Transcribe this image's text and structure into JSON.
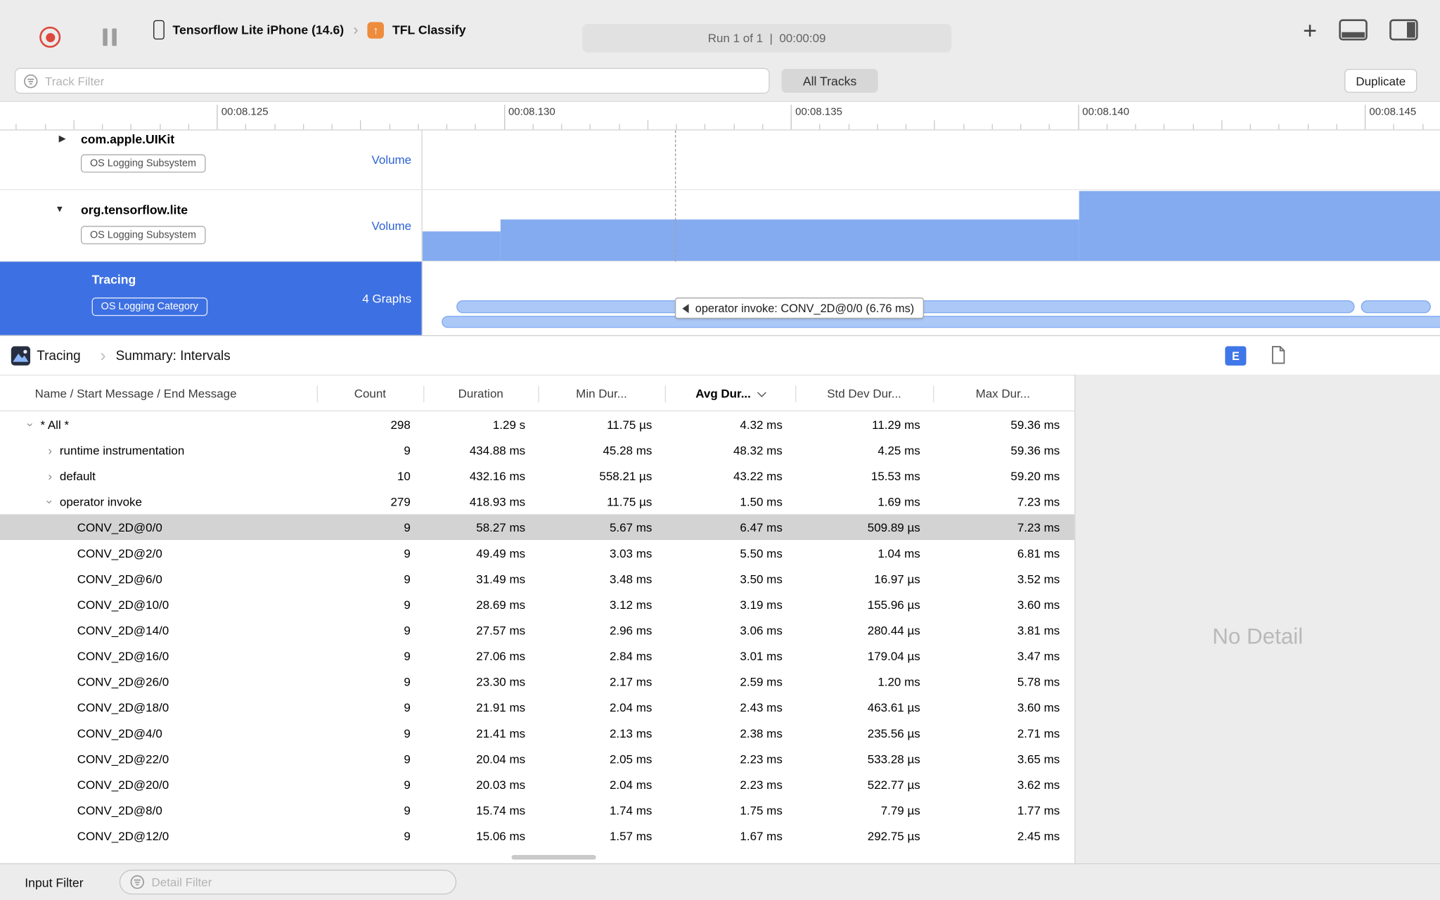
{
  "toolbar": {
    "device": "Tensorflow Lite iPhone (14.6)",
    "app": "TFL Classify",
    "run_status": "Run 1 of 1  |  00:00:09"
  },
  "filter_bar": {
    "track_filter_placeholder": "Track Filter",
    "all_tracks": "All Tracks",
    "duplicate": "Duplicate"
  },
  "timeline": {
    "tick_labels": [
      "00:08.125",
      "00:08.130",
      "00:08.135",
      "00:08.140",
      "00:08.145"
    ]
  },
  "tracks": [
    {
      "name": "com.apple.UIKit",
      "badge": "OS Logging Subsystem",
      "meta": "Volume"
    },
    {
      "name": "org.tensorflow.lite",
      "badge": "OS Logging Subsystem",
      "meta": "Volume"
    },
    {
      "name": "Tracing",
      "badge": "OS Logging Category",
      "meta": "4 Graphs"
    }
  ],
  "graph_tooltip": "operator invoke: CONV_2D@0/0 (6.76 ms)",
  "detail": {
    "breadcrumb_root": "Tracing",
    "breadcrumb_page": "Summary: Intervals",
    "extended_detail_button": "E",
    "no_detail": "No Detail",
    "input_filter_label": "Input Filter",
    "detail_filter_placeholder": "Detail Filter"
  },
  "icons": {
    "plus": "+",
    "chevron": "›",
    "tri_closed": "▶",
    "tri_open": "▼",
    "arrow_up": "↑"
  },
  "table": {
    "columns": [
      "Name / Start Message / End Message",
      "Count",
      "Duration",
      "Min Dur...",
      "Avg Dur...",
      "Std Dev Dur...",
      "Max Dur..."
    ],
    "sort_column": "Avg Dur...",
    "rows": [
      {
        "indent": 1,
        "disclosure": "open",
        "name": "* All *",
        "count": "298",
        "duration": "1.29 s",
        "min": "11.75 µs",
        "avg": "4.32 ms",
        "std": "11.29 ms",
        "max": "59.36 ms"
      },
      {
        "indent": 2,
        "disclosure": "closed",
        "name": "runtime instrumentation",
        "count": "9",
        "duration": "434.88 ms",
        "min": "45.28 ms",
        "avg": "48.32 ms",
        "std": "4.25 ms",
        "max": "59.36 ms"
      },
      {
        "indent": 2,
        "disclosure": "closed",
        "name": "default",
        "count": "10",
        "duration": "432.16 ms",
        "min": "558.21 µs",
        "avg": "43.22 ms",
        "std": "15.53 ms",
        "max": "59.20 ms"
      },
      {
        "indent": 2,
        "disclosure": "open",
        "name": "operator invoke",
        "count": "279",
        "duration": "418.93 ms",
        "min": "11.75 µs",
        "avg": "1.50 ms",
        "std": "1.69 ms",
        "max": "7.23 ms"
      },
      {
        "indent": 3,
        "name": "CONV_2D@0/0",
        "count": "9",
        "duration": "58.27 ms",
        "min": "5.67 ms",
        "avg": "6.47 ms",
        "std": "509.89 µs",
        "max": "7.23 ms",
        "selected": true
      },
      {
        "indent": 3,
        "name": "CONV_2D@2/0",
        "count": "9",
        "duration": "49.49 ms",
        "min": "3.03 ms",
        "avg": "5.50 ms",
        "std": "1.04 ms",
        "max": "6.81 ms"
      },
      {
        "indent": 3,
        "name": "CONV_2D@6/0",
        "count": "9",
        "duration": "31.49 ms",
        "min": "3.48 ms",
        "avg": "3.50 ms",
        "std": "16.97 µs",
        "max": "3.52 ms"
      },
      {
        "indent": 3,
        "name": "CONV_2D@10/0",
        "count": "9",
        "duration": "28.69 ms",
        "min": "3.12 ms",
        "avg": "3.19 ms",
        "std": "155.96 µs",
        "max": "3.60 ms"
      },
      {
        "indent": 3,
        "name": "CONV_2D@14/0",
        "count": "9",
        "duration": "27.57 ms",
        "min": "2.96 ms",
        "avg": "3.06 ms",
        "std": "280.44 µs",
        "max": "3.81 ms"
      },
      {
        "indent": 3,
        "name": "CONV_2D@16/0",
        "count": "9",
        "duration": "27.06 ms",
        "min": "2.84 ms",
        "avg": "3.01 ms",
        "std": "179.04 µs",
        "max": "3.47 ms"
      },
      {
        "indent": 3,
        "name": "CONV_2D@26/0",
        "count": "9",
        "duration": "23.30 ms",
        "min": "2.17 ms",
        "avg": "2.59 ms",
        "std": "1.20 ms",
        "max": "5.78 ms"
      },
      {
        "indent": 3,
        "name": "CONV_2D@18/0",
        "count": "9",
        "duration": "21.91 ms",
        "min": "2.04 ms",
        "avg": "2.43 ms",
        "std": "463.61 µs",
        "max": "3.60 ms"
      },
      {
        "indent": 3,
        "name": "CONV_2D@4/0",
        "count": "9",
        "duration": "21.41 ms",
        "min": "2.13 ms",
        "avg": "2.38 ms",
        "std": "235.56 µs",
        "max": "2.71 ms"
      },
      {
        "indent": 3,
        "name": "CONV_2D@22/0",
        "count": "9",
        "duration": "20.04 ms",
        "min": "2.05 ms",
        "avg": "2.23 ms",
        "std": "533.28 µs",
        "max": "3.65 ms"
      },
      {
        "indent": 3,
        "name": "CONV_2D@20/0",
        "count": "9",
        "duration": "20.03 ms",
        "min": "2.04 ms",
        "avg": "2.23 ms",
        "std": "522.77 µs",
        "max": "3.62 ms"
      },
      {
        "indent": 3,
        "name": "CONV_2D@8/0",
        "count": "9",
        "duration": "15.74 ms",
        "min": "1.74 ms",
        "avg": "1.75 ms",
        "std": "7.79 µs",
        "max": "1.77 ms"
      },
      {
        "indent": 3,
        "name": "CONV_2D@12/0",
        "count": "9",
        "duration": "15.06 ms",
        "min": "1.57 ms",
        "avg": "1.67 ms",
        "std": "292.75 µs",
        "max": "2.45 ms"
      }
    ]
  }
}
